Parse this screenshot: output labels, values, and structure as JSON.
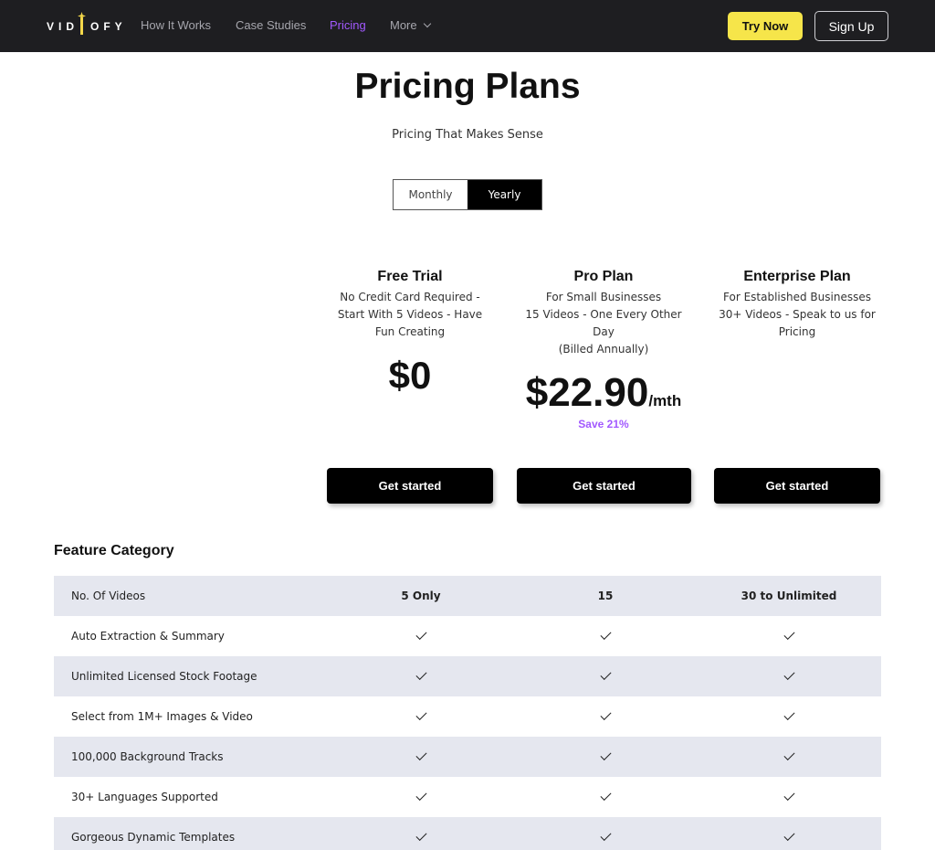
{
  "nav": {
    "logo_left": "VID",
    "logo_right": "OFY",
    "items": [
      {
        "label": "How It Works",
        "active": false
      },
      {
        "label": "Case Studies",
        "active": false
      },
      {
        "label": "Pricing",
        "active": true
      },
      {
        "label": "More",
        "active": false,
        "icon": "chevron-down-icon"
      }
    ],
    "try_now": "Try Now",
    "sign_up": "Sign Up"
  },
  "colors": {
    "nav_bg": "#1e1e21",
    "accent": "#a259ff",
    "brand_yellow": "#f6e54a",
    "row_shade": "#e5e7ef"
  },
  "hero": {
    "title": "Pricing Plans",
    "subtitle": "Pricing That Makes Sense",
    "billing_options": [
      "Monthly",
      "Yearly"
    ],
    "selected_billing": "Yearly"
  },
  "plans": [
    {
      "name": "Free Trial",
      "description": [
        "No Credit Card Required -",
        "Start With 5 Videos - Have",
        "Fun Creating"
      ],
      "price": "$0",
      "cta": "Get started"
    },
    {
      "name": "Pro Plan",
      "description": [
        "For Small Businesses",
        "15 Videos - One Every Other",
        "Day",
        "(Billed Annually)"
      ],
      "price": "$22.90",
      "price_unit": "/mth",
      "save": "Save 21%",
      "cta": "Get started"
    },
    {
      "name": "Enterprise Plan",
      "description": [
        "For Established Businesses",
        "30+ Videos - Speak to us for",
        "Pricing"
      ],
      "cta": "Get started"
    }
  ],
  "features": {
    "heading": "Feature Category",
    "rows": [
      {
        "label": "No. Of Videos",
        "values": [
          "5 Only",
          "15",
          "30 to Unlimited"
        ]
      },
      {
        "label": "Auto Extraction & Summary",
        "values": [
          "check",
          "check",
          "check"
        ]
      },
      {
        "label": "Unlimited Licensed Stock Footage",
        "values": [
          "check",
          "check",
          "check"
        ]
      },
      {
        "label": "Select from 1M+ Images & Video",
        "values": [
          "check",
          "check",
          "check"
        ]
      },
      {
        "label": "100,000 Background Tracks",
        "values": [
          "check",
          "check",
          "check"
        ]
      },
      {
        "label": "30+ Languages Supported",
        "values": [
          "check",
          "check",
          "check"
        ]
      },
      {
        "label": "Gorgeous Dynamic Templates",
        "values": [
          "check",
          "check",
          "check"
        ]
      }
    ]
  }
}
